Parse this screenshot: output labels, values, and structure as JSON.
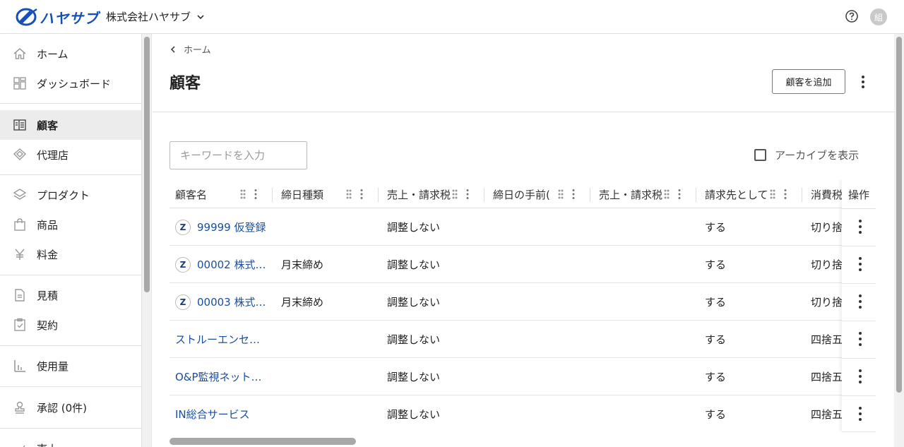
{
  "header": {
    "logo_text": "ハヤサブ",
    "company_name": "株式会社ハヤサブ",
    "avatar_initial": "組"
  },
  "sidebar": {
    "items": [
      {
        "label": "ホーム",
        "icon": "home-icon"
      },
      {
        "label": "ダッシュボード",
        "icon": "dashboard-icon"
      },
      {
        "label": "顧客",
        "icon": "customer-icon",
        "active": true
      },
      {
        "label": "代理店",
        "icon": "agency-icon"
      },
      {
        "label": "プロダクト",
        "icon": "layers-icon"
      },
      {
        "label": "商品",
        "icon": "bag-icon"
      },
      {
        "label": "料金",
        "icon": "yen-icon"
      },
      {
        "label": "見積",
        "icon": "document-icon"
      },
      {
        "label": "契約",
        "icon": "clipboard-check-icon"
      },
      {
        "label": "使用量",
        "icon": "bar-chart-icon"
      },
      {
        "label": "承認 (0件)",
        "icon": "stamp-icon"
      },
      {
        "label": "売上",
        "icon": "sales-icon"
      }
    ]
  },
  "main": {
    "breadcrumb": "ホーム",
    "title": "顧客",
    "add_button": "顧客を追加",
    "search_placeholder": "キーワードを入力",
    "archive_label": "アーカイブを表示"
  },
  "table": {
    "columns": [
      "顧客名",
      "締日種類",
      "売上・請求税",
      "締日の手前(",
      "売上・請求税",
      "請求先として",
      "消費税",
      "操作"
    ],
    "rows": [
      {
        "z": true,
        "name": "99999 仮登録",
        "closing": "",
        "adjust": "調整しない",
        "col4": "",
        "col5": "",
        "billing": "する",
        "tax": "切り捨"
      },
      {
        "z": true,
        "name": "00002 株式…",
        "closing": "月末締め",
        "adjust": "調整しない",
        "col4": "",
        "col5": "",
        "billing": "する",
        "tax": "切り捨"
      },
      {
        "z": true,
        "name": "00003 株式…",
        "closing": "月末締め",
        "adjust": "調整しない",
        "col4": "",
        "col5": "",
        "billing": "する",
        "tax": "切り捨"
      },
      {
        "z": false,
        "name": "ストルーエンセ…",
        "closing": "",
        "adjust": "調整しない",
        "col4": "",
        "col5": "",
        "billing": "する",
        "tax": "四捨五"
      },
      {
        "z": false,
        "name": "O&P監視ネット…",
        "closing": "",
        "adjust": "調整しない",
        "col4": "",
        "col5": "",
        "billing": "する",
        "tax": "四捨五"
      },
      {
        "z": false,
        "name": "IN総合サービス",
        "closing": "",
        "adjust": "調整しない",
        "col4": "",
        "col5": "",
        "billing": "する",
        "tax": "四捨五"
      }
    ]
  },
  "colors": {
    "brand": "#1550b8",
    "link": "#1a4fa0",
    "active_bg": "#ececec"
  }
}
